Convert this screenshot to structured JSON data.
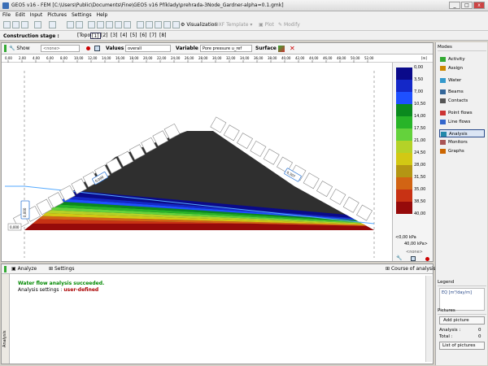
{
  "window": {
    "title": "GEO5 v16 - FEM [C:\\Users\\Public\\Documents\\Fine\\GEO5 v16 Příklady\\prehrada-3Node_Gardner-alpha=0.1.gmk]",
    "minimize": "_",
    "maximize": "□",
    "close": "x"
  },
  "menu": [
    "File",
    "Edit",
    "Input",
    "Pictures",
    "Settings",
    "Help"
  ],
  "toolbar": {
    "visualization": "Visualization",
    "dxf_template": "DXF Template",
    "plot": "Plot",
    "modify": "Modify"
  },
  "stages": {
    "label": "Construction stage :",
    "items": [
      "[Topo]",
      "[1]",
      "[2]",
      "[3]",
      "[4]",
      "[5]",
      "[6]",
      "[7]",
      "[8]"
    ],
    "selected_index": 1
  },
  "viewbar": {
    "show": "Show",
    "none_combo": "<none>",
    "values_label": "Values :",
    "values_value": "overall",
    "variable_label": "Variable :",
    "variable_value": "Pore pressure u_ref",
    "surface_label": "Surface :"
  },
  "ruler": {
    "ticks": [
      "0,00",
      "2,00",
      "4,00",
      "6,00",
      "8,00",
      "10,00",
      "12,00",
      "14,00",
      "16,00",
      "18,00",
      "20,00",
      "22,00",
      "24,00",
      "26,00",
      "28,00",
      "30,00",
      "32,00",
      "34,00",
      "36,00",
      "38,00",
      "40,00",
      "42,00",
      "44,00",
      "46,00",
      "48,00",
      "50,00",
      "52,00"
    ],
    "unit": "[m]"
  },
  "legend_scale": {
    "labels": [
      "0,00",
      "3,50",
      "7,00",
      "10,50",
      "14,00",
      "17,50",
      "21,00",
      "24,50",
      "28,00",
      "31,50",
      "35,00",
      "38,50",
      "40,00"
    ],
    "colors": [
      "#0a0a8a",
      "#1428c8",
      "#1e50ff",
      "#0a8a1e",
      "#28b428",
      "#64d23c",
      "#b4d228",
      "#d2c814",
      "#b49614",
      "#d26414",
      "#c83214",
      "#960a0a"
    ],
    "min_text": "<0,00 kPa",
    "max_text": "40,00 kPa>",
    "none_text": "<none>"
  },
  "drawing_labels": {
    "left_water_tag": "0,000",
    "mid_tag": "0,000",
    "right_tag": "0,307",
    "depth_tag": "0,000"
  },
  "bottom": {
    "analyze": "Analyze",
    "settings": "Settings",
    "course": "Course of analysis",
    "msg1": "Water flow analysis succeeded.",
    "msg2_label": "Analysis settings :",
    "msg2_value": "user-defined",
    "side_tab": "Analysis"
  },
  "modes": {
    "title": "Modes",
    "items": [
      {
        "label": "Activity",
        "icon": "activity-icon"
      },
      {
        "label": "Assign",
        "icon": "assign-icon"
      },
      {
        "label": "Water",
        "icon": "water-icon"
      },
      {
        "label": "Beams",
        "icon": "beams-icon"
      },
      {
        "label": "Contacts",
        "icon": "contacts-icon"
      },
      {
        "label": "Point flows",
        "icon": "point-flows-icon"
      },
      {
        "label": "Line flows",
        "icon": "line-flows-icon"
      },
      {
        "label": "Analysis",
        "icon": "analysis-icon"
      },
      {
        "label": "Monitors",
        "icon": "monitors-icon"
      },
      {
        "label": "Graphs",
        "icon": "graphs-icon"
      }
    ],
    "selected": "Analysis"
  },
  "legend_panel": {
    "title": "Legend",
    "item": "EQ [m³/day/m]"
  },
  "pictures": {
    "title": "Pictures",
    "add": "Add picture",
    "analysis_label": "Analysis :",
    "analysis_count": "0",
    "total_label": "Total :",
    "total_count": "0",
    "list": "List of pictures"
  }
}
